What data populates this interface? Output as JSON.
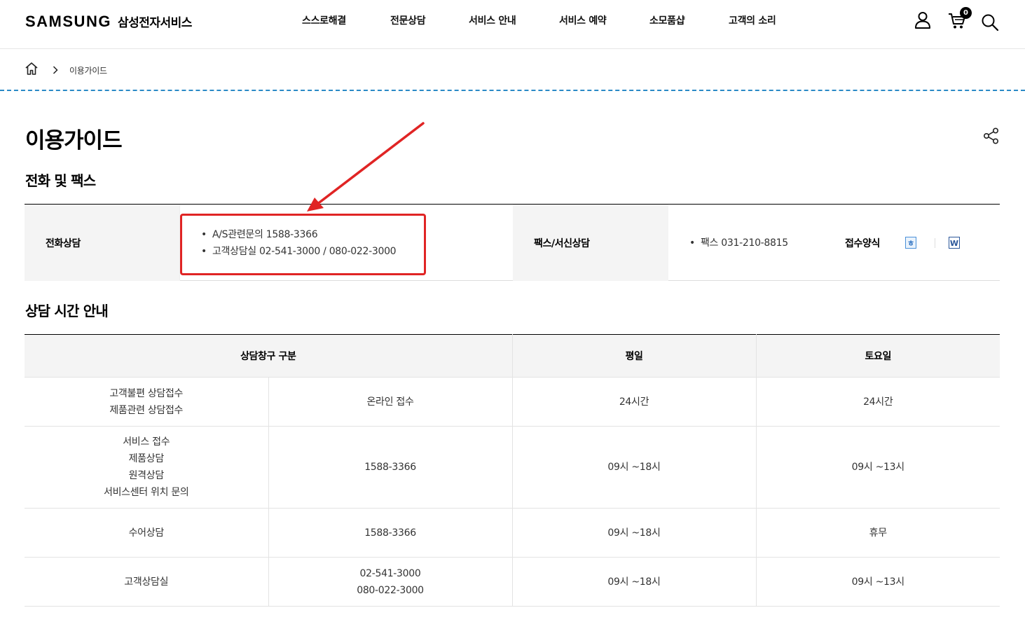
{
  "header": {
    "logo_word": "SAMSUNG",
    "logo_sub": "삼성전자서비스",
    "nav": [
      "스스로해결",
      "전문상담",
      "서비스 안내",
      "서비스 예약",
      "소모품샵",
      "고객의 소리"
    ],
    "cart_count": "0"
  },
  "breadcrumb": {
    "current": "이용가이드"
  },
  "page": {
    "title": "이용가이드",
    "section_phone": "전화 및 팩스",
    "section_hours": "상담 시간 안내"
  },
  "phone_table": {
    "phone_label": "전화상담",
    "phone_items": [
      "A/S관련문의 1588-3366",
      "고객상담실 02-541-3000 / 080-022-3000"
    ],
    "fax_label": "팩스/서신상담",
    "fax_items": [
      "팩스 031-210-8815"
    ],
    "form_label": "접수양식"
  },
  "hours_table": {
    "headers": [
      "상담창구 구분",
      "평일",
      "토요일"
    ],
    "rows": [
      {
        "category": "고객불편 상담접수\n제품관련 상담접수",
        "channel": "온라인 접수",
        "weekday": "24시간",
        "saturday": "24시간"
      },
      {
        "category": "서비스 접수\n제품상담\n원격상담\n서비스센터 위치 문의",
        "channel": "1588-3366",
        "weekday": "09시 ~18시",
        "saturday": "09시 ~13시"
      },
      {
        "category": "수어상담",
        "channel": "1588-3366",
        "weekday": "09시 ~18시",
        "saturday": "휴무"
      },
      {
        "category": "고객상담실",
        "channel": "02-541-3000\n080-022-3000",
        "weekday": "09시 ~18시",
        "saturday": "09시 ~13시"
      }
    ]
  },
  "annotation": {
    "color": "#e02424"
  },
  "colors": {
    "accent_dash": "#2a89c6",
    "header_bg": "#f4f4f4"
  }
}
